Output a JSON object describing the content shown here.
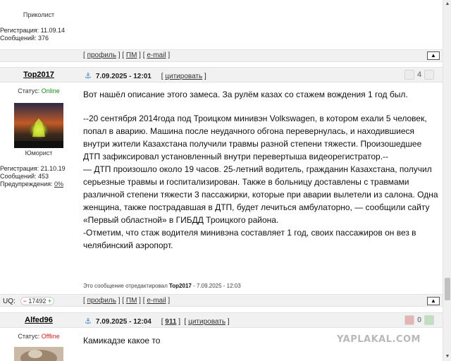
{
  "prev_user": {
    "rank": "Приколист",
    "registration": "Регистрация: 11.09.14",
    "messages": "Сообщений: 376",
    "links": {
      "profile": "профиль",
      "pm": "ПМ",
      "email": "e-mail"
    }
  },
  "post1": {
    "author": "Top2017",
    "status_label": "Статус:",
    "status_value": "Online",
    "rank": "Юморист",
    "registration": "Регистрация: 21.10.19",
    "messages": "Сообщений: 453",
    "warnings_label": "Предупреждения:",
    "warnings_value": "0%",
    "date": "7.09.2025 - 12:01",
    "quote_label": "цитировать",
    "vote_count": "4",
    "paragraphs": [
      "Вот нашёл описание этого замеса. За рулём казах со стажем вождения 1 год был.",
      "",
      "--20 сентября 2014года под Троицком минивэн Volkswagen, в котором ехали 5 человек, попал в аварию. Машина после неудачного обгона перевернулась, и находившиеся внутри жители Казахстана получили травмы разной степени тяжести. Произошедшее ДТП зафиксировал установленный внутри перевертыша видеорегистратор.--",
      "— ДТП произошло около 19 часов. 25-летний водитель, гражданин Казахстана, получил серьезные травмы и госпитализирован. Также в больницу доставлены с травмами различной степени тяжести 3 пассажирки, которые при аварии вылетели из салона. Одна женщина, также пострадавшая в ДТП, будет лечиться амбулаторно, — сообщили сайту «Первый областной» в ГИБДД Троицкого района.",
      "-Отметим, что стаж водителя минивэна составляет 1 год, своих пассажиров он вез в челябинский аэропорт."
    ],
    "edited_prefix": "Это сообщение отредактировал",
    "edited_user": "Top2017",
    "edited_date": "- 7.09.2025 - 12:03",
    "uq_label": "UQ:",
    "uq_value": "17492",
    "uq_minus": "−",
    "uq_plus": "+",
    "links": {
      "profile": "профиль",
      "pm": "ПМ",
      "email": "e-mail"
    }
  },
  "post2": {
    "author": "Alfed96",
    "status_label": "Статус:",
    "status_value": "Offline",
    "date": "7.09.2025 - 12:04",
    "minus_count": "911",
    "quote_label": "цитировать",
    "vote_count": "0",
    "text": "Камикадзе какое то"
  },
  "watermark": "YAPLAKAL.COM",
  "icons": {
    "anchor": "anchor-icon",
    "up": "scroll-to-top-icon",
    "vote_up": "thumb-up-icon",
    "vote_down": "thumb-down-icon"
  },
  "colors": {
    "online": "#1a8a1a",
    "offline": "#cc2222",
    "bar_bg": "#f1f1f1"
  }
}
